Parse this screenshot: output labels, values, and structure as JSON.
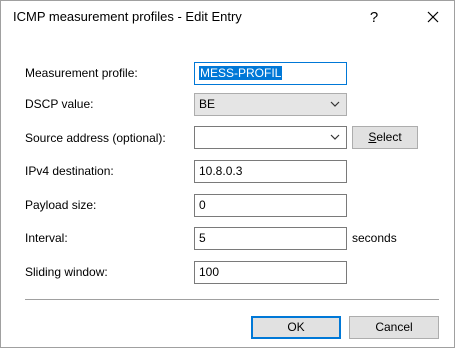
{
  "window": {
    "title": "ICMP measurement profiles - Edit Entry",
    "help_label": "?"
  },
  "form": {
    "profile_label": "Measurement profile:",
    "profile_value": "MESS-PROFIL",
    "dscp_label": "DSCP value:",
    "dscp_value": "BE",
    "source_label": "Source address (optional):",
    "source_value": "",
    "select_label": "Select",
    "ipv4_label": "IPv4 destination:",
    "ipv4_value": "10.8.0.3",
    "payload_label": "Payload size:",
    "payload_value": "0",
    "interval_label": "Interval:",
    "interval_value": "5",
    "interval_unit": "seconds",
    "sliding_label": "Sliding window:",
    "sliding_value": "100"
  },
  "buttons": {
    "ok_label": "OK",
    "cancel_label": "Cancel"
  }
}
